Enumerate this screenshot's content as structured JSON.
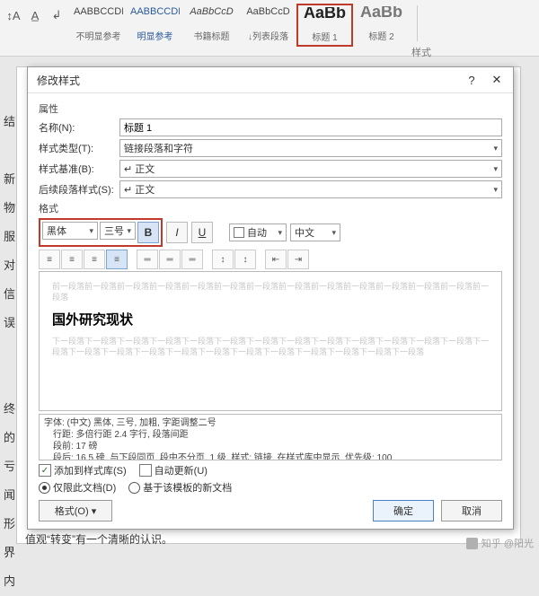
{
  "ribbon": {
    "styles": [
      {
        "preview": "AABBCCDI",
        "label": "不明显参考",
        "cls": ""
      },
      {
        "preview": "AABBCCDI",
        "label": "明显参考",
        "cls": "sp-blue"
      },
      {
        "preview": "AaBbCcD",
        "label": "书籍标题",
        "cls": "sp-italic"
      },
      {
        "preview": "AaBbCcD",
        "label": "↓列表段落",
        "cls": ""
      },
      {
        "preview": "AaBb",
        "label": "标题 1",
        "cls": "sp-big"
      },
      {
        "preview": "AaBb",
        "label": "标题 2",
        "cls": "sp-big"
      }
    ],
    "group_label": "样式"
  },
  "dialog": {
    "title": "修改样式",
    "sect_props": "属性",
    "name_label": "名称(N):",
    "name_value": "标题 1",
    "type_label": "样式类型(T):",
    "type_value": "链接段落和字符",
    "base_label": "样式基准(B):",
    "base_value": "↵ 正文",
    "next_label": "后续段落样式(S):",
    "next_value": "↵ 正文",
    "sect_format": "格式",
    "font_name": "黑体",
    "font_size": "三号",
    "bold": "B",
    "italic": "I",
    "underline": "U",
    "color": "自动",
    "lang": "中文",
    "ghost1": "前一段落前一段落前一段落前一段落前一段落前一段落前一段落前一段落前一段落前一段落前一段落前一段落前一段落前一段落",
    "sample": "国外研究现状",
    "ghost2": "下一段落下一段落下一段落下一段落下一段落下一段落下一段落下一段落下一段落下一段落下一段落下一段落下一段落下一段落下一段落下一段落下一段落下一段落下一段落下一段落下一段落下一段落下一段落下一段落下一段落",
    "desc1": "字体: (中文) 黑体, 三号, 加粗, 字距调整二号",
    "desc2": "　行距: 多倍行距 2.4 字行, 段落间距",
    "desc3": "　段前: 17 磅",
    "desc4": "　段后: 16.5 磅, 与下段同页, 段中不分页, 1 级, 样式: 链接, 在样式库中显示, 优先级: 100",
    "add_gallery": "添加到样式库(S)",
    "auto_update": "自动更新(U)",
    "only_doc": "仅限此文档(D)",
    "based_template": "基于该模板的新文档",
    "format_btn": "格式(O) ▾",
    "ok": "确定",
    "cancel": "取消"
  },
  "left": "结\n\n新\n物\n服\n对\n信\n误\n\n\n终\n的\n亏\n闻\n形\n界\n内",
  "bottom": "值观“转变”有一个清晰的认识。",
  "water": "知乎 @阳光"
}
